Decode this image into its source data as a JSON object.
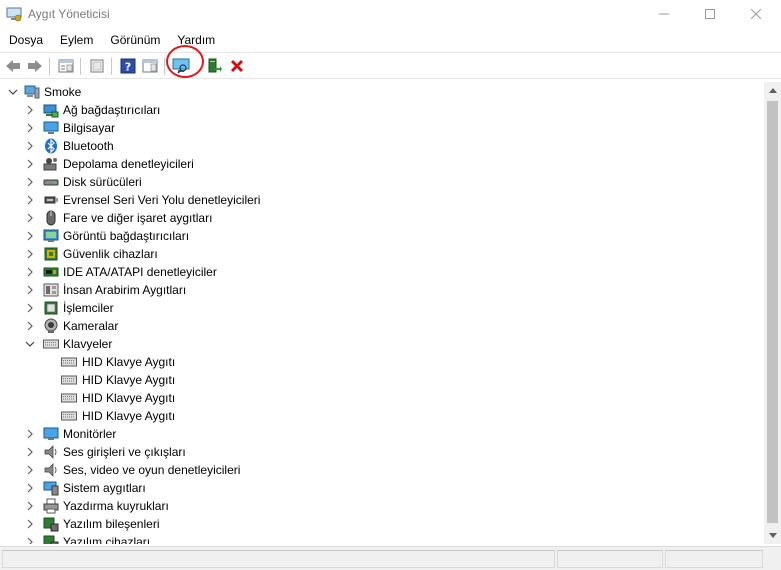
{
  "window": {
    "title": "Aygıt Yöneticisi",
    "controls": [
      "minimize",
      "maximize",
      "close"
    ]
  },
  "menu": {
    "items": [
      "Dosya",
      "Eylem",
      "Görünüm",
      "Yardım"
    ]
  },
  "toolbar": {
    "buttons": [
      "back-icon",
      "forward-icon",
      "properties-view-icon",
      "update-list-icon",
      "help-icon",
      "action-pane-icon",
      "scan-hardware-icon",
      "update-driver-icon",
      "uninstall-device-icon"
    ],
    "highlighted": "scan-hardware-icon",
    "highlight_color": "#e01818"
  },
  "tree": {
    "root": "Smoke",
    "categories": [
      "Ağ bağdaştırıcıları",
      "Bilgisayar",
      "Bluetooth",
      "Depolama denetleyicileri",
      "Disk sürücüleri",
      "Evrensel Seri Veri Yolu denetleyicileri",
      "Fare ve diğer işaret aygıtları",
      "Görüntü bağdaştırıcıları",
      "Güvenlik cihazları",
      "IDE ATA/ATAPI denetleyiciler",
      "İnsan Arabirim Aygıtları",
      "İşlemciler",
      "Kameralar",
      "Klavyeler",
      "Monitörler",
      "Ses girişleri ve çıkışları",
      "Ses, video ve oyun denetleyicileri",
      "Sistem aygıtları",
      "Yazdırma kuyrukları",
      "Yazılım bileşenleri",
      "Yazılım cihazları"
    ],
    "expanded_category": "Klavyeler",
    "keyboard_children": [
      "HID Klavye Aygıtı",
      "HID Klavye Aygıtı",
      "HID Klavye Aygıtı",
      "HID Klavye Aygıtı"
    ]
  },
  "colors": {
    "accent_blue": "#1e7bd6",
    "text_gray": "#7a7a7a",
    "uninstall_red": "#d01010"
  }
}
